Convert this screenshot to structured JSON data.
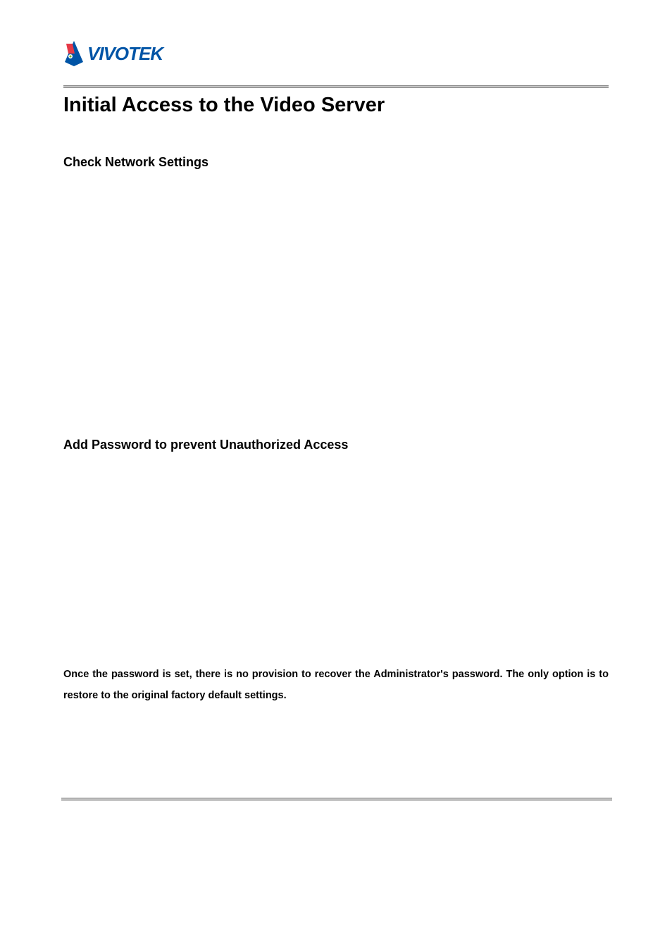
{
  "logo": {
    "brand": "VIVOTEK"
  },
  "heading": "Initial Access to the Video Server",
  "section1": {
    "title": "Check Network Settings"
  },
  "section2": {
    "title": "Add Password to prevent Unauthorized Access"
  },
  "warning": {
    "lead": "Once the password is set, there is no provision to recover the Administrator's password.  The only option is to restore to the original factory default settings."
  }
}
